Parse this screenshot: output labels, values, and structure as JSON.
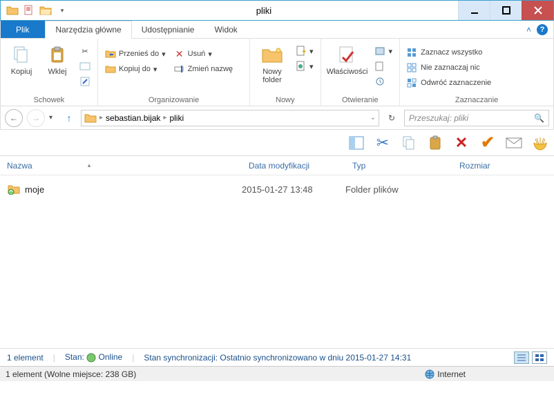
{
  "window": {
    "title": "pliki"
  },
  "tabs": {
    "file": "Plik",
    "home": "Narzędzia główne",
    "share": "Udostępnianie",
    "view": "Widok"
  },
  "ribbon": {
    "clipboard": {
      "label": "Schowek",
      "copy": "Kopiuj",
      "paste": "Wklej"
    },
    "organize": {
      "label": "Organizowanie",
      "moveTo": "Przenieś do",
      "copyTo": "Kopiuj do",
      "delete": "Usuń",
      "rename": "Zmień nazwę"
    },
    "new": {
      "label": "Nowy",
      "newFolder": "Nowy folder"
    },
    "open": {
      "label": "Otwieranie",
      "properties": "Właściwości"
    },
    "select": {
      "label": "Zaznaczanie",
      "selectAll": "Zaznacz wszystko",
      "selectNone": "Nie zaznaczaj nic",
      "invert": "Odwróć zaznaczenie"
    }
  },
  "breadcrumb": {
    "parts": [
      "sebastian.bijak",
      "pliki"
    ]
  },
  "search": {
    "placeholder": "Przeszukaj: pliki"
  },
  "columns": {
    "name": "Nazwa",
    "date": "Data modyfikacji",
    "type": "Typ",
    "size": "Rozmiar"
  },
  "files": [
    {
      "name": "moje",
      "date": "2015-01-27 13:48",
      "type": "Folder plików"
    }
  ],
  "status1": {
    "count": "1 element",
    "stateLabel": "Stan:",
    "state": "Online",
    "syncLabel": "Stan synchronizacji:",
    "syncText": "Ostatnio synchronizowano w dniu 2015-01-27 14:31"
  },
  "status2": {
    "text": "1 element (Wolne miejsce: 238 GB)",
    "zone": "Internet"
  }
}
